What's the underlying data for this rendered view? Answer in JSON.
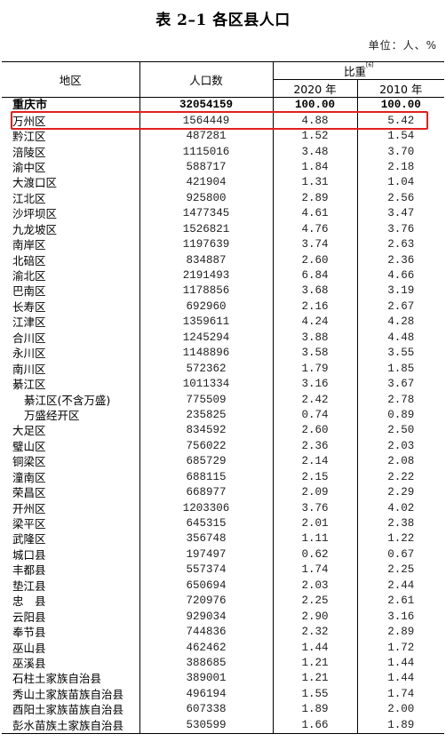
{
  "title": "表 2–1 各区县人口",
  "unit": "单位：人、%",
  "headers": {
    "region": "地区",
    "population": "人口数",
    "ratio": "比重",
    "ratio_note": "[6]",
    "year_2020": "2020 年",
    "year_2010": "2010 年"
  },
  "highlight": {
    "row": "万州区",
    "color": "#e02020"
  },
  "rows": [
    {
      "name": "重庆市",
      "pop": "32054159",
      "r2020": "100.00",
      "r2010": "100.00",
      "total": true
    },
    {
      "name": "万州区",
      "pop": "1564449",
      "r2020": "4.88",
      "r2010": "5.42"
    },
    {
      "name": "黔江区",
      "pop": "487281",
      "r2020": "1.52",
      "r2010": "1.54"
    },
    {
      "name": "涪陵区",
      "pop": "1115016",
      "r2020": "3.48",
      "r2010": "3.70"
    },
    {
      "name": "渝中区",
      "pop": "588717",
      "r2020": "1.84",
      "r2010": "2.18"
    },
    {
      "name": "大渡口区",
      "pop": "421904",
      "r2020": "1.31",
      "r2010": "1.04"
    },
    {
      "name": "江北区",
      "pop": "925800",
      "r2020": "2.89",
      "r2010": "2.56"
    },
    {
      "name": "沙坪坝区",
      "pop": "1477345",
      "r2020": "4.61",
      "r2010": "3.47"
    },
    {
      "name": "九龙坡区",
      "pop": "1526821",
      "r2020": "4.76",
      "r2010": "3.76"
    },
    {
      "name": "南岸区",
      "pop": "1197639",
      "r2020": "3.74",
      "r2010": "2.63"
    },
    {
      "name": "北碚区",
      "pop": "834887",
      "r2020": "2.60",
      "r2010": "2.36"
    },
    {
      "name": "渝北区",
      "pop": "2191493",
      "r2020": "6.84",
      "r2010": "4.66"
    },
    {
      "name": "巴南区",
      "pop": "1178856",
      "r2020": "3.68",
      "r2010": "3.19"
    },
    {
      "name": "长寿区",
      "pop": "692960",
      "r2020": "2.16",
      "r2010": "2.67"
    },
    {
      "name": "江津区",
      "pop": "1359611",
      "r2020": "4.24",
      "r2010": "4.28"
    },
    {
      "name": "合川区",
      "pop": "1245294",
      "r2020": "3.88",
      "r2010": "4.48"
    },
    {
      "name": "永川区",
      "pop": "1148896",
      "r2020": "3.58",
      "r2010": "3.55"
    },
    {
      "name": "南川区",
      "pop": "572362",
      "r2020": "1.79",
      "r2010": "1.85"
    },
    {
      "name": "綦江区",
      "pop": "1011334",
      "r2020": "3.16",
      "r2010": "3.67"
    },
    {
      "name": "綦江区(不含万盛)",
      "pop": "775509",
      "r2020": "2.42",
      "r2010": "2.78",
      "sub": true
    },
    {
      "name": "万盛经开区",
      "pop": "235825",
      "r2020": "0.74",
      "r2010": "0.89",
      "sub": true
    },
    {
      "name": "大足区",
      "pop": "834592",
      "r2020": "2.60",
      "r2010": "2.50"
    },
    {
      "name": "璧山区",
      "pop": "756022",
      "r2020": "2.36",
      "r2010": "2.03"
    },
    {
      "name": "铜梁区",
      "pop": "685729",
      "r2020": "2.14",
      "r2010": "2.08"
    },
    {
      "name": "潼南区",
      "pop": "688115",
      "r2020": "2.15",
      "r2010": "2.22"
    },
    {
      "name": "荣昌区",
      "pop": "668977",
      "r2020": "2.09",
      "r2010": "2.29"
    },
    {
      "name": "开州区",
      "pop": "1203306",
      "r2020": "3.76",
      "r2010": "4.02"
    },
    {
      "name": "梁平区",
      "pop": "645315",
      "r2020": "2.01",
      "r2010": "2.38"
    },
    {
      "name": "武隆区",
      "pop": "356748",
      "r2020": "1.11",
      "r2010": "1.22"
    },
    {
      "name": "城口县",
      "pop": "197497",
      "r2020": "0.62",
      "r2010": "0.67"
    },
    {
      "name": "丰都县",
      "pop": "557374",
      "r2020": "1.74",
      "r2010": "2.25"
    },
    {
      "name": "垫江县",
      "pop": "650694",
      "r2020": "2.03",
      "r2010": "2.44"
    },
    {
      "name": "忠　县",
      "pop": "720976",
      "r2020": "2.25",
      "r2010": "2.61"
    },
    {
      "name": "云阳县",
      "pop": "929034",
      "r2020": "2.90",
      "r2010": "3.16"
    },
    {
      "name": "奉节县",
      "pop": "744836",
      "r2020": "2.32",
      "r2010": "2.89"
    },
    {
      "name": "巫山县",
      "pop": "462462",
      "r2020": "1.44",
      "r2010": "1.72"
    },
    {
      "name": "巫溪县",
      "pop": "388685",
      "r2020": "1.21",
      "r2010": "1.44"
    },
    {
      "name": "石柱土家族自治县",
      "pop": "389001",
      "r2020": "1.21",
      "r2010": "1.44"
    },
    {
      "name": "秀山土家族苗族自治县",
      "pop": "496194",
      "r2020": "1.55",
      "r2010": "1.74"
    },
    {
      "name": "酉阳土家族苗族自治县",
      "pop": "607338",
      "r2020": "1.89",
      "r2010": "2.00"
    },
    {
      "name": "彭水苗族土家族自治县",
      "pop": "530599",
      "r2020": "1.66",
      "r2010": "1.89"
    }
  ]
}
